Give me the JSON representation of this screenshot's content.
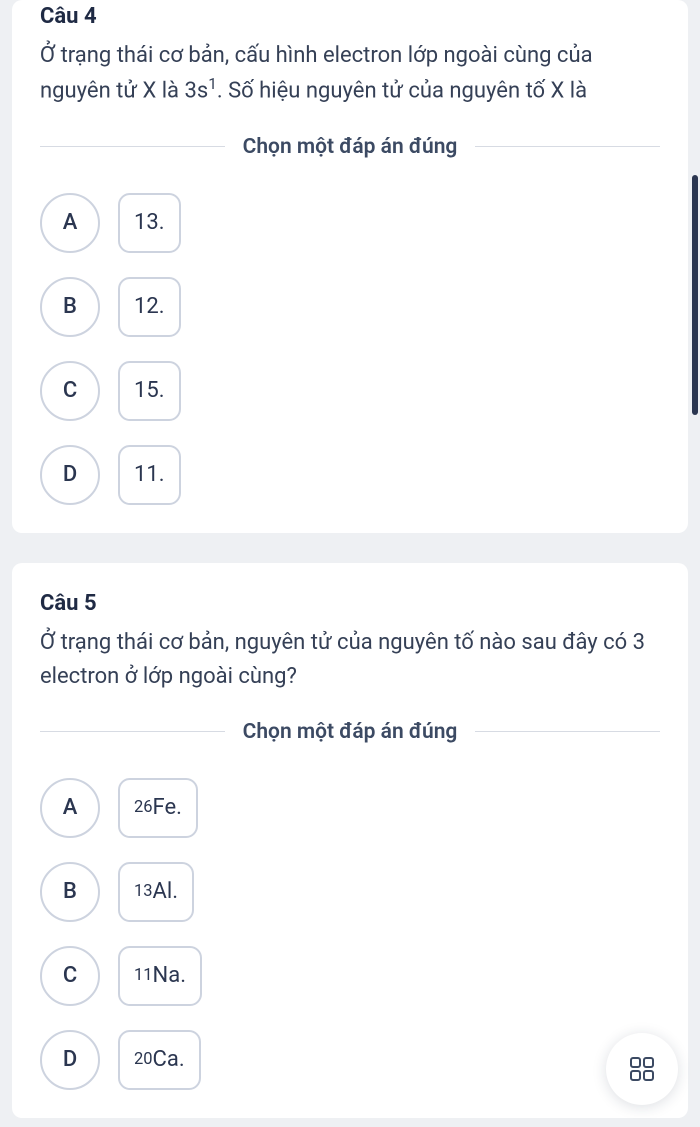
{
  "questions": [
    {
      "title": "Câu 4",
      "body_html": "Ở trạng thái cơ bản, cấu hình electron lớp ngoài cùng của nguyên tử X là 3s<span class='sup'>1</span>. Số hiệu nguyên tử của nguyên tố X là",
      "instruction": "Chọn một đáp án đúng",
      "options": [
        {
          "letter": "A",
          "value_html": "13."
        },
        {
          "letter": "B",
          "value_html": "12."
        },
        {
          "letter": "C",
          "value_html": "15."
        },
        {
          "letter": "D",
          "value_html": "11."
        }
      ]
    },
    {
      "title": "Câu 5",
      "body_html": "Ở trạng thái cơ bản, nguyên tử của nguyên tố nào sau đây có 3 electron ở lớp ngoài cùng?",
      "instruction": "Chọn một đáp án đúng",
      "options": [
        {
          "letter": "A",
          "value_html": "<span class='sub'>26</span>Fe."
        },
        {
          "letter": "B",
          "value_html": "<span class='sub'>13</span>Al."
        },
        {
          "letter": "C",
          "value_html": "<span class='sub'>11</span>Na."
        },
        {
          "letter": "D",
          "value_html": "<span class='sub'>20</span>Ca."
        }
      ]
    }
  ]
}
